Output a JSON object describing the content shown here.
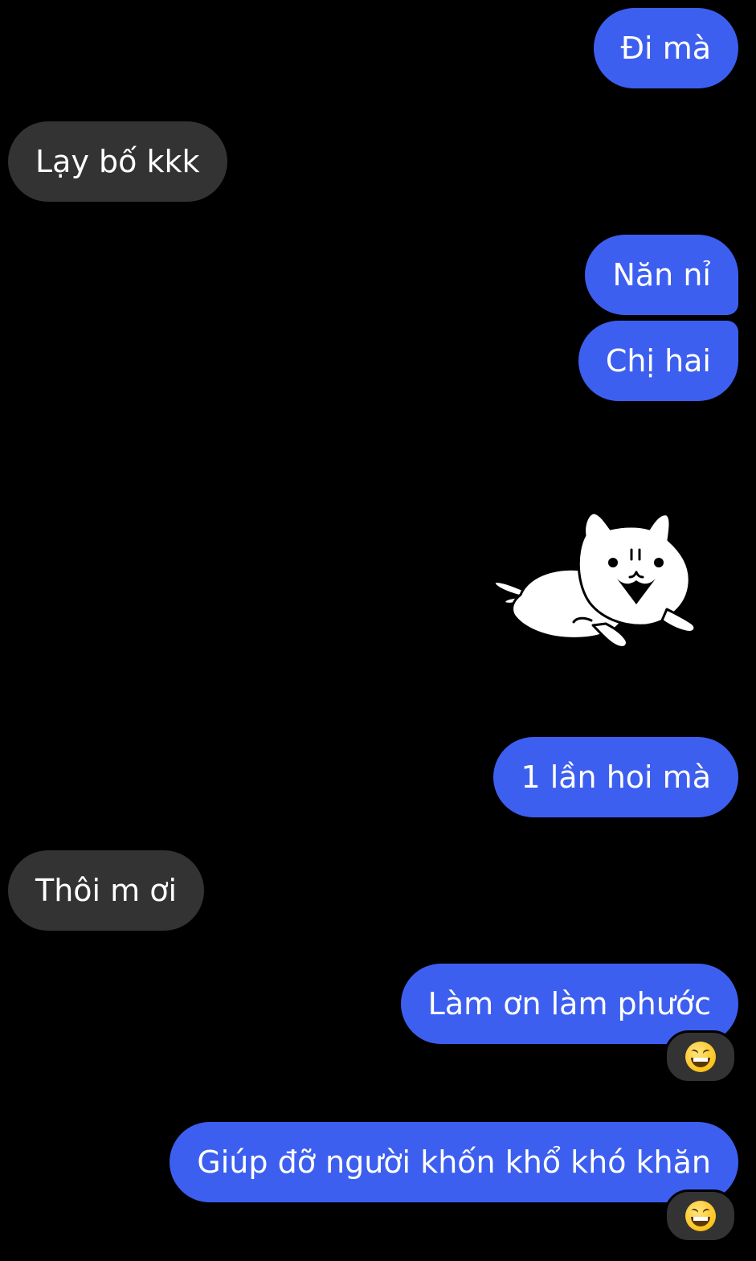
{
  "messages": [
    {
      "id": "m1",
      "side": "sent",
      "text": "Đi mà"
    },
    {
      "id": "m2",
      "side": "received",
      "text": "Lạy bố kkk"
    },
    {
      "id": "m3",
      "side": "sent",
      "text": "Năn nỉ"
    },
    {
      "id": "m4",
      "side": "sent",
      "text": "Chị hai"
    },
    {
      "id": "m5",
      "side": "sent",
      "type": "sticker",
      "sticker": "white-cat-sticker"
    },
    {
      "id": "m6",
      "side": "sent",
      "text": "1 lần hoi mà"
    },
    {
      "id": "m7",
      "side": "received",
      "text": "Thôi m ơi"
    },
    {
      "id": "m8",
      "side": "sent",
      "text": "Làm ơn làm phước",
      "reaction": "grinning-squinting-face-emoji"
    },
    {
      "id": "m9",
      "side": "sent",
      "text": "Giúp đỡ người khốn khổ khó khăn",
      "reaction": "grinning-squinting-face-emoji"
    }
  ],
  "colors": {
    "background": "#000000",
    "sent_bubble": "#3d5ff0",
    "received_bubble": "#333333",
    "text": "#ffffff"
  }
}
